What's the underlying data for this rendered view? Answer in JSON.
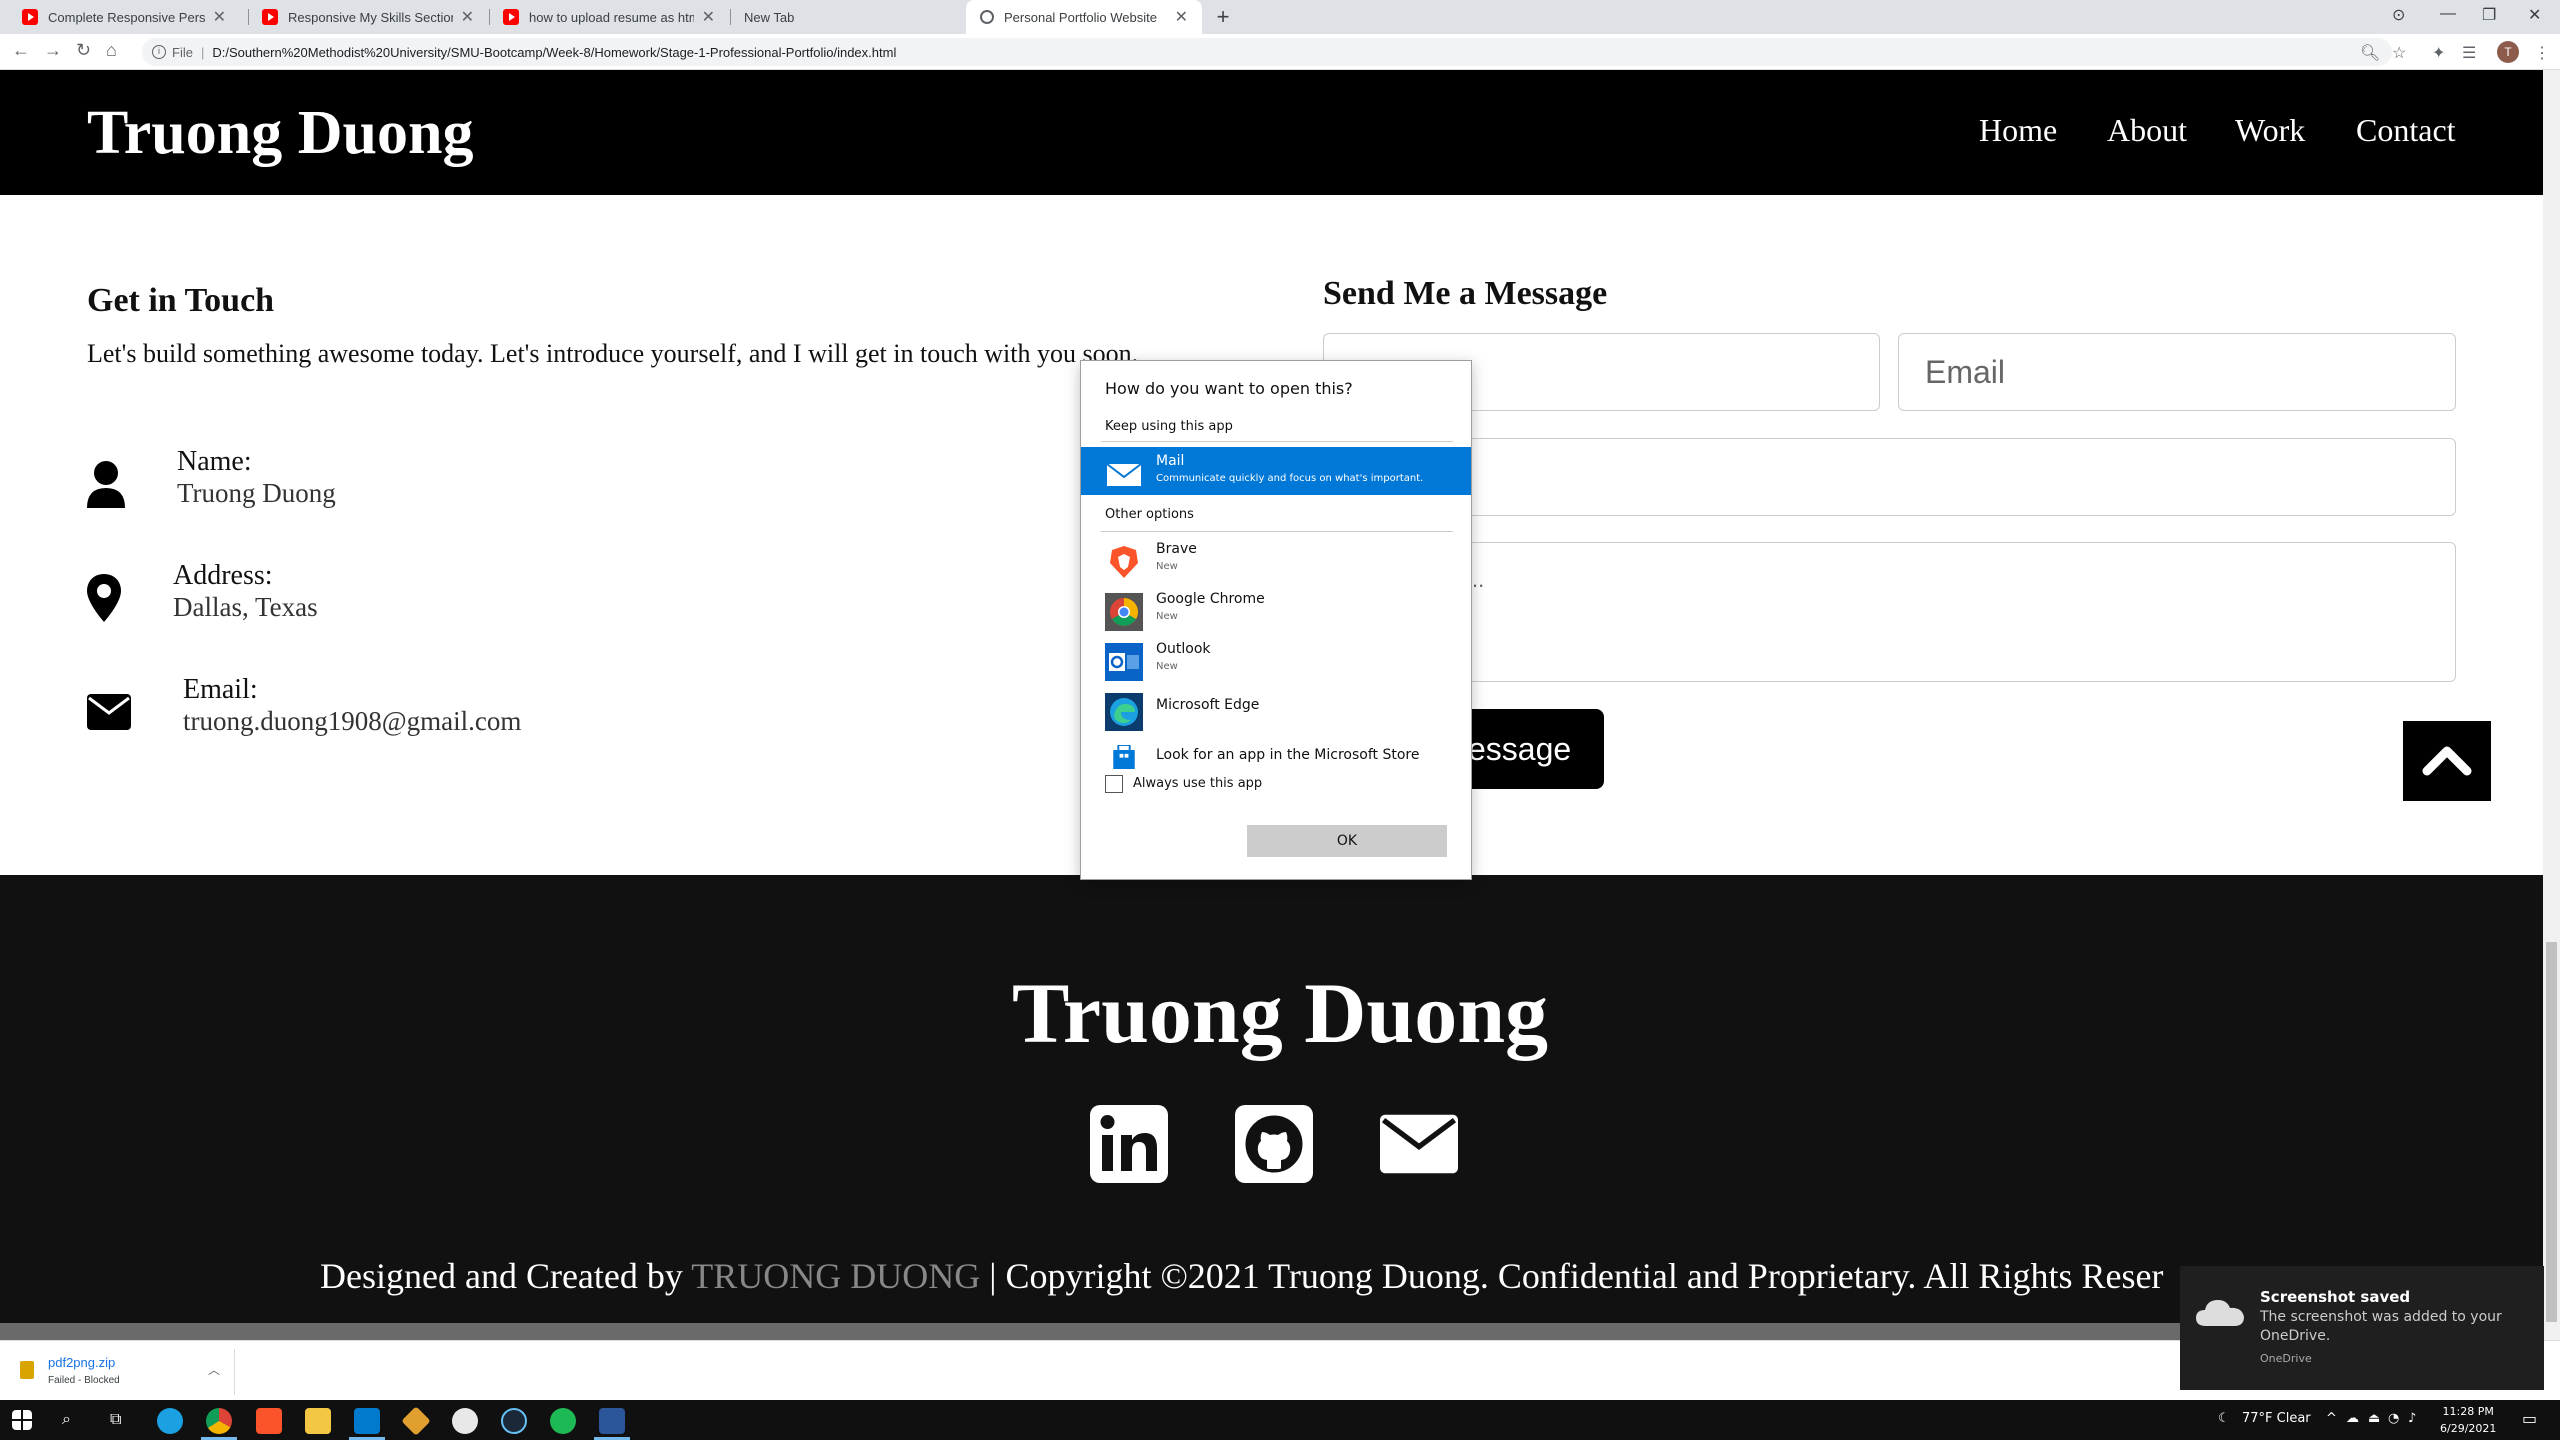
{
  "browser": {
    "tabs": [
      {
        "title": "Complete Responsive Personal P",
        "icon": "youtube-icon"
      },
      {
        "title": "Responsive My Skills Section Usi",
        "icon": "youtube-icon"
      },
      {
        "title": "how to upload resume as html -",
        "icon": "youtube-icon"
      },
      {
        "title": "New Tab",
        "icon": "none"
      },
      {
        "title": "Personal Portfolio Website",
        "icon": "globe-icon"
      }
    ],
    "address_prefix": "File",
    "url": "D:/Southern%20Methodist%20University/SMU-Bootcamp/Week-8/Homework/Stage-1-Professional-Portfolio/index.html",
    "profile_initial": "T"
  },
  "site": {
    "brand": "Truong Duong",
    "nav": [
      "Home",
      "About",
      "Work",
      "Contact"
    ]
  },
  "contact": {
    "heading": "Get in Touch",
    "intro": "Let's build something awesome today. Let's introduce yourself, and I will get in touch with you soon.",
    "items": [
      {
        "label": "Name:",
        "value": "Truong Duong",
        "icon": "user-icon"
      },
      {
        "label": "Address:",
        "value": "Dallas, Texas",
        "icon": "map-marker-icon"
      },
      {
        "label": "Email:",
        "value": "truong.duong1908@gmail.com",
        "icon": "envelope-icon"
      }
    ]
  },
  "message_form": {
    "heading": "Send Me a Message",
    "email_placeholder": "Email",
    "message_partial": "..",
    "send_partial": "essage"
  },
  "footer": {
    "brand": "Truong Duong",
    "social": [
      "linkedin-icon",
      "github-icon",
      "envelope-icon"
    ],
    "copyright_prefix": "Designed and Created by",
    "copyright_name": "TRUONG DUONG",
    "copyright_rest": "| Copyright ©2021 Truong Duong. Confidential and Proprietary. All Rights Reser"
  },
  "dialog": {
    "question": "How do you want to open this?",
    "keep_label": "Keep using this app",
    "selected_app": {
      "name": "Mail",
      "sub": "Communicate quickly and focus on what's important."
    },
    "other_label": "Other options",
    "apps": [
      {
        "name": "Brave",
        "sub": "New"
      },
      {
        "name": "Google Chrome",
        "sub": "New"
      },
      {
        "name": "Outlook",
        "sub": "New"
      },
      {
        "name": "Microsoft Edge",
        "sub": ""
      },
      {
        "name": "Look for an app in the Microsoft Store",
        "sub": ""
      }
    ],
    "always_label": "Always use this app",
    "ok_label": "OK"
  },
  "download": {
    "filename": "pdf2png.zip",
    "status": "Failed - Blocked"
  },
  "toast": {
    "title": "Screenshot saved",
    "body": "The screenshot was added to your OneDrive.",
    "source": "OneDrive"
  },
  "taskbar": {
    "weather": "77°F  Clear",
    "time": "11:28 PM",
    "date": "6/29/2021"
  },
  "colors": {
    "header_bg": "#000000",
    "footer_bg": "#111111",
    "dialog_accent": "#0078d7"
  }
}
